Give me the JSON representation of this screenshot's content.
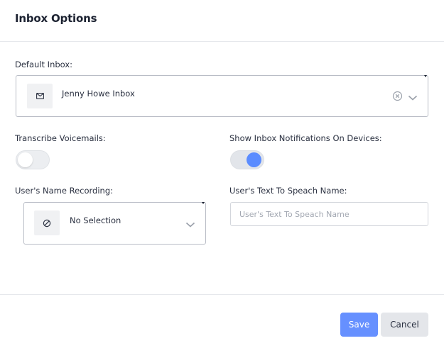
{
  "dialog": {
    "title": "Inbox Options"
  },
  "default_inbox": {
    "label": "Default Inbox:",
    "selected": "Jenny Howe Inbox",
    "icon": "envelope-icon"
  },
  "transcribe": {
    "label": "Transcribe Voicemails:",
    "enabled": false
  },
  "notifications": {
    "label": "Show Inbox Notifications On Devices:",
    "enabled": true,
    "accent": "#5b8cff"
  },
  "name_recording": {
    "label": "User's Name Recording:",
    "selected": "No Selection",
    "icon": "no-selection-icon"
  },
  "tts_name": {
    "label": "User's Text To Speach Name:",
    "value": "",
    "placeholder": "User's Text To Speach Name"
  },
  "footer": {
    "save_label": "Save",
    "cancel_label": "Cancel",
    "save_color": "#6690ff"
  }
}
